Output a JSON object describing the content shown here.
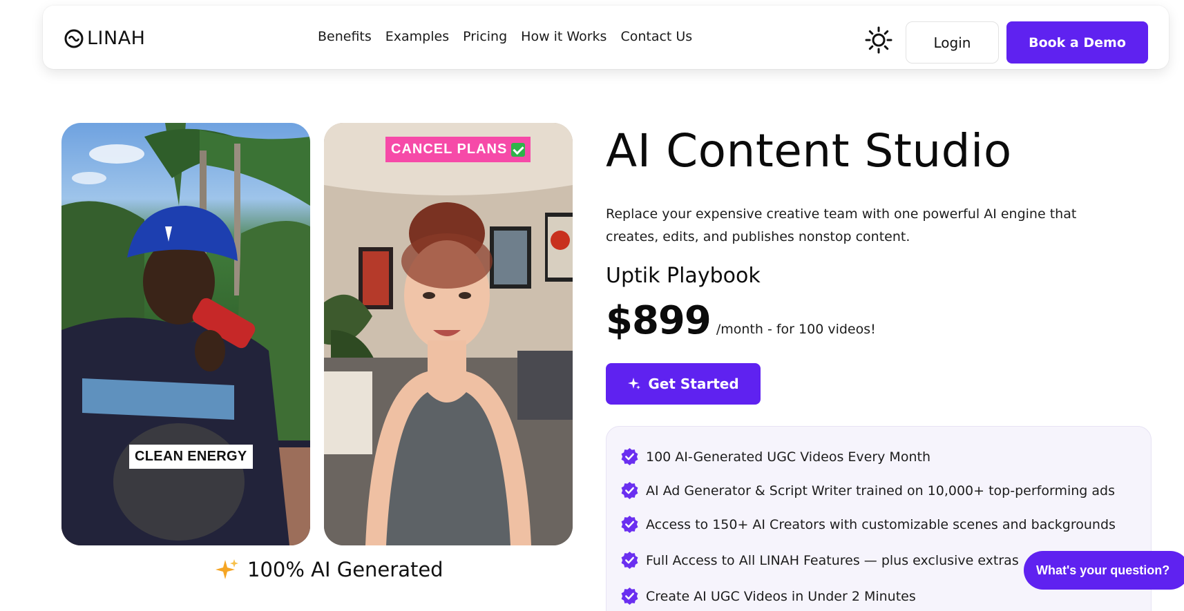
{
  "header": {
    "logo_text": "LINAH",
    "nav": [
      {
        "label": "Benefits"
      },
      {
        "label": "Examples"
      },
      {
        "label": "Pricing"
      },
      {
        "label": "How it Works"
      },
      {
        "label": "Contact Us"
      }
    ],
    "login_label": "Login",
    "demo_label": "Book a Demo"
  },
  "media": {
    "card1_tag": "CLEAN ENERGY",
    "card2_tag": "CANCEL PLANS",
    "caption": "100% AI Generated"
  },
  "hero": {
    "title": "AI Content Studio",
    "subtitle": "Replace your expensive creative team with one powerful AI engine that creates, edits, and publishes nonstop content.",
    "plan_name": "Uptik Playbook",
    "price": "$899",
    "price_note": "/month - for 100 videos!",
    "cta_label": "Get Started"
  },
  "features": [
    "100 AI-Generated UGC Videos Every Month",
    "AI Ad Generator & Script Writer trained on 10,000+ top-performing ads",
    "Access to 150+ AI Creators with customizable scenes and backgrounds",
    "Full Access to All LINAH Features — plus exclusive extras",
    "Create AI UGC Videos in Under 2 Minutes"
  ],
  "chat": {
    "label": "What's your question?"
  },
  "colors": {
    "accent": "#5f22f0",
    "tag_pink": "#f64aa8",
    "feature_bg": "#f6f4fc"
  },
  "icons": {
    "theme_toggle": "sun-icon",
    "cta_icon": "sparkle-icon",
    "feature_icon": "verified-badge-icon"
  }
}
